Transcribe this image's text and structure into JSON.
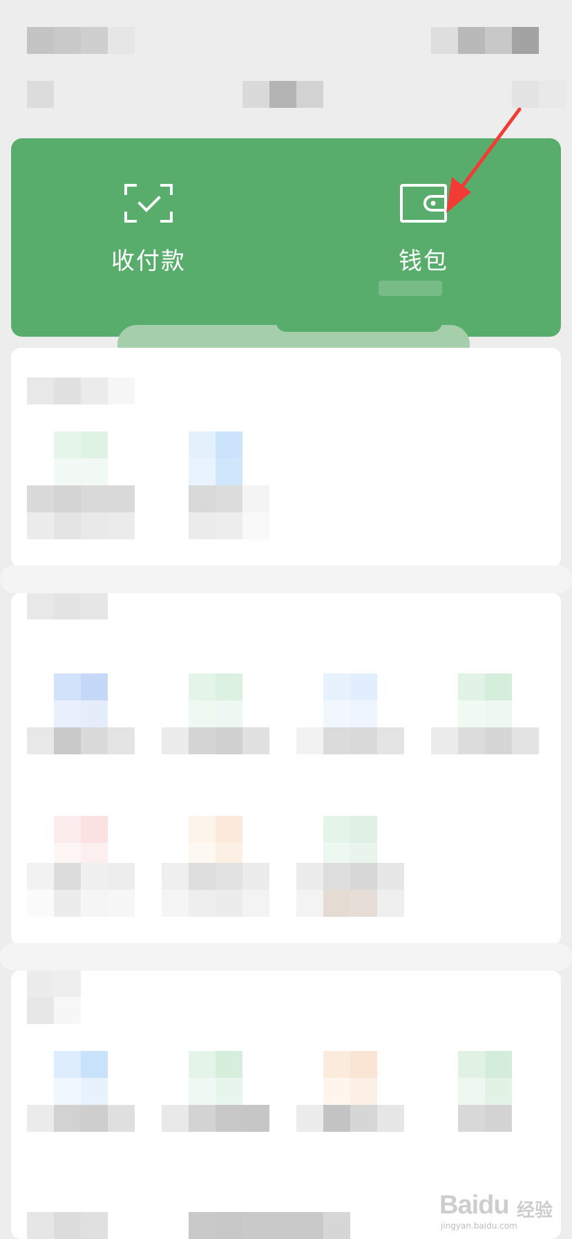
{
  "wallet_panel": {
    "pay_label": "收付款",
    "wallet_label": "钱包"
  },
  "icons": {
    "pay": "scan-qr-icon",
    "wallet": "wallet-icon",
    "annotation": "red-arrow-icon"
  },
  "colors": {
    "panel_green": "#59ad6c",
    "background": "#ededed",
    "card": "#ffffff",
    "arrow": "#f23b35"
  },
  "watermark": {
    "brand": "Baidu",
    "brand_suffix": "经验",
    "url": "jingyan.baidu.com"
  }
}
